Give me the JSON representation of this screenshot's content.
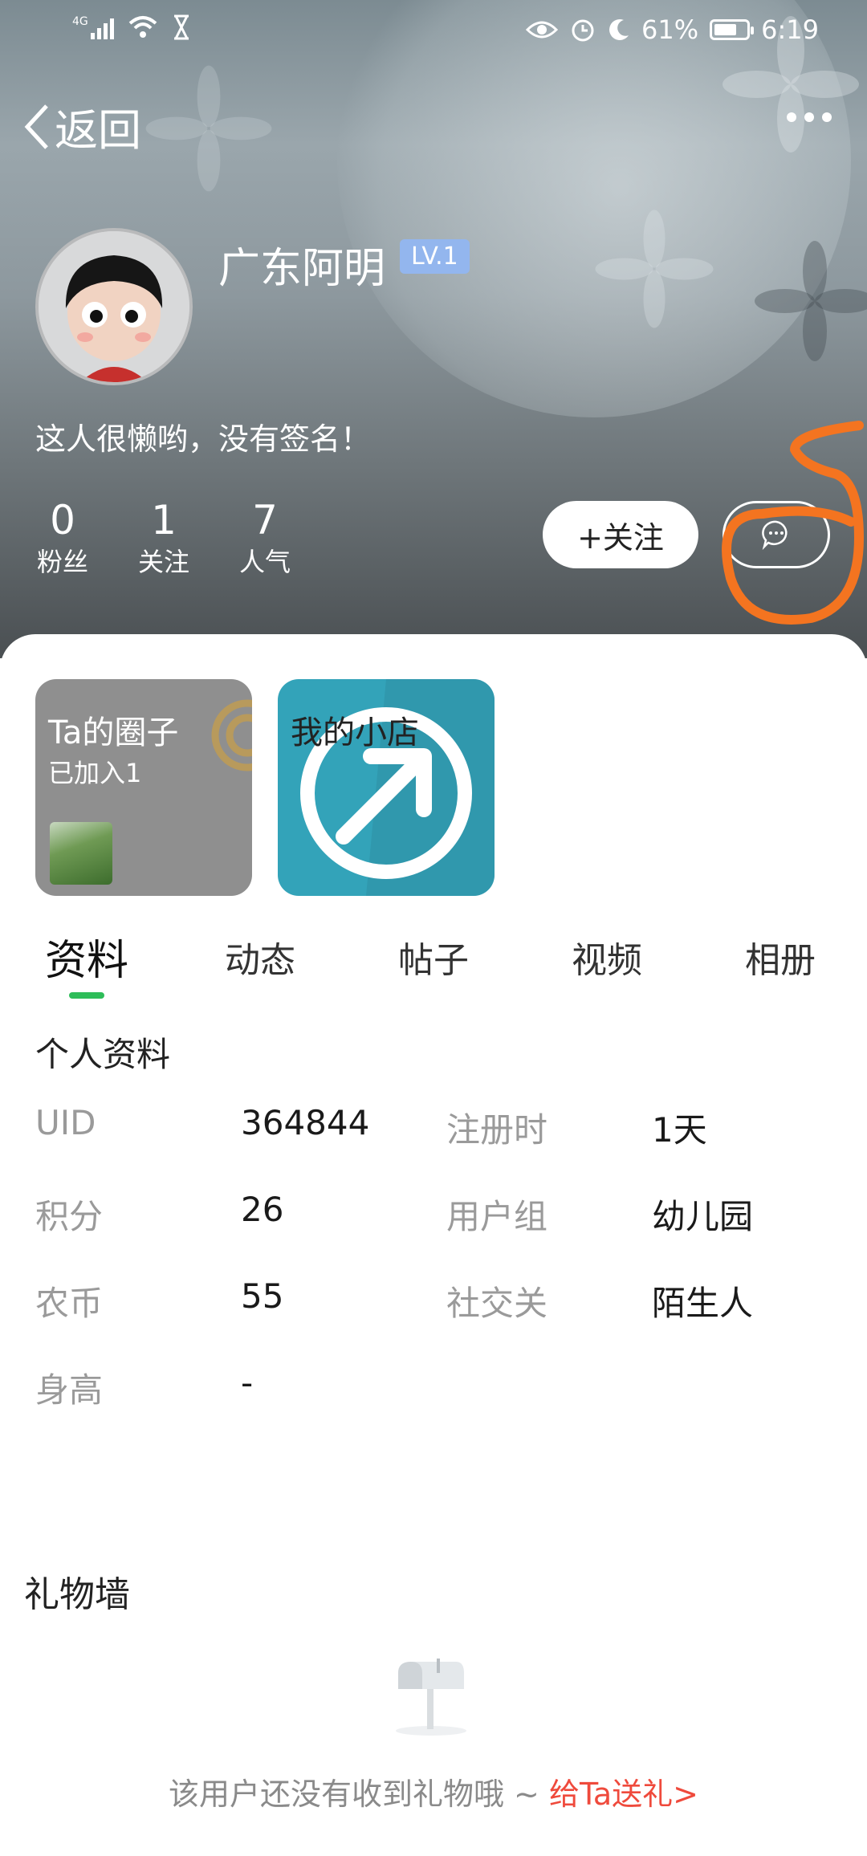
{
  "status_bar": {
    "network": "4G",
    "battery_percent": "61%",
    "time": "6:19"
  },
  "header": {
    "back_label": "返回"
  },
  "profile": {
    "name": "广东阿明",
    "level": "LV.1",
    "signature": "这人很懒哟，没有签名！",
    "stats": [
      {
        "value": "0",
        "label": "粉丝"
      },
      {
        "value": "1",
        "label": "关注"
      },
      {
        "value": "7",
        "label": "人气"
      }
    ],
    "follow_label": "+关注"
  },
  "annotation": {
    "text": "6",
    "color": "#f47420"
  },
  "tiles": {
    "circle": {
      "title": "Ta的圈子",
      "subtitle": "已加入1"
    },
    "shop": {
      "title": "我的小店"
    }
  },
  "tabs": [
    {
      "label": "资料",
      "active": true
    },
    {
      "label": "动态",
      "active": false
    },
    {
      "label": "帖子",
      "active": false
    },
    {
      "label": "视频",
      "active": false
    },
    {
      "label": "相册",
      "active": false
    }
  ],
  "info": {
    "title": "个人资料",
    "rows": [
      {
        "k1": "UID",
        "v1": "364844",
        "k2": "注册时",
        "v2": "1天"
      },
      {
        "k1": "积分",
        "v1": "26",
        "k2": "用户组",
        "v2": "幼儿园"
      },
      {
        "k1": "农币",
        "v1": "55",
        "k2": "社交关",
        "v2": "陌生人"
      },
      {
        "k1": "身高",
        "v1": "-",
        "k2": "",
        "v2": ""
      }
    ]
  },
  "gifts": {
    "title": "礼物墙",
    "empty_text": "该用户还没有收到礼物哦 ~ ",
    "send_link": "给Ta送礼>"
  },
  "colors": {
    "accent_green": "#2ebd59",
    "link_red": "#ef4a3c",
    "level_badge": "#93b6ee",
    "shop_teal": "#33a3b9"
  }
}
